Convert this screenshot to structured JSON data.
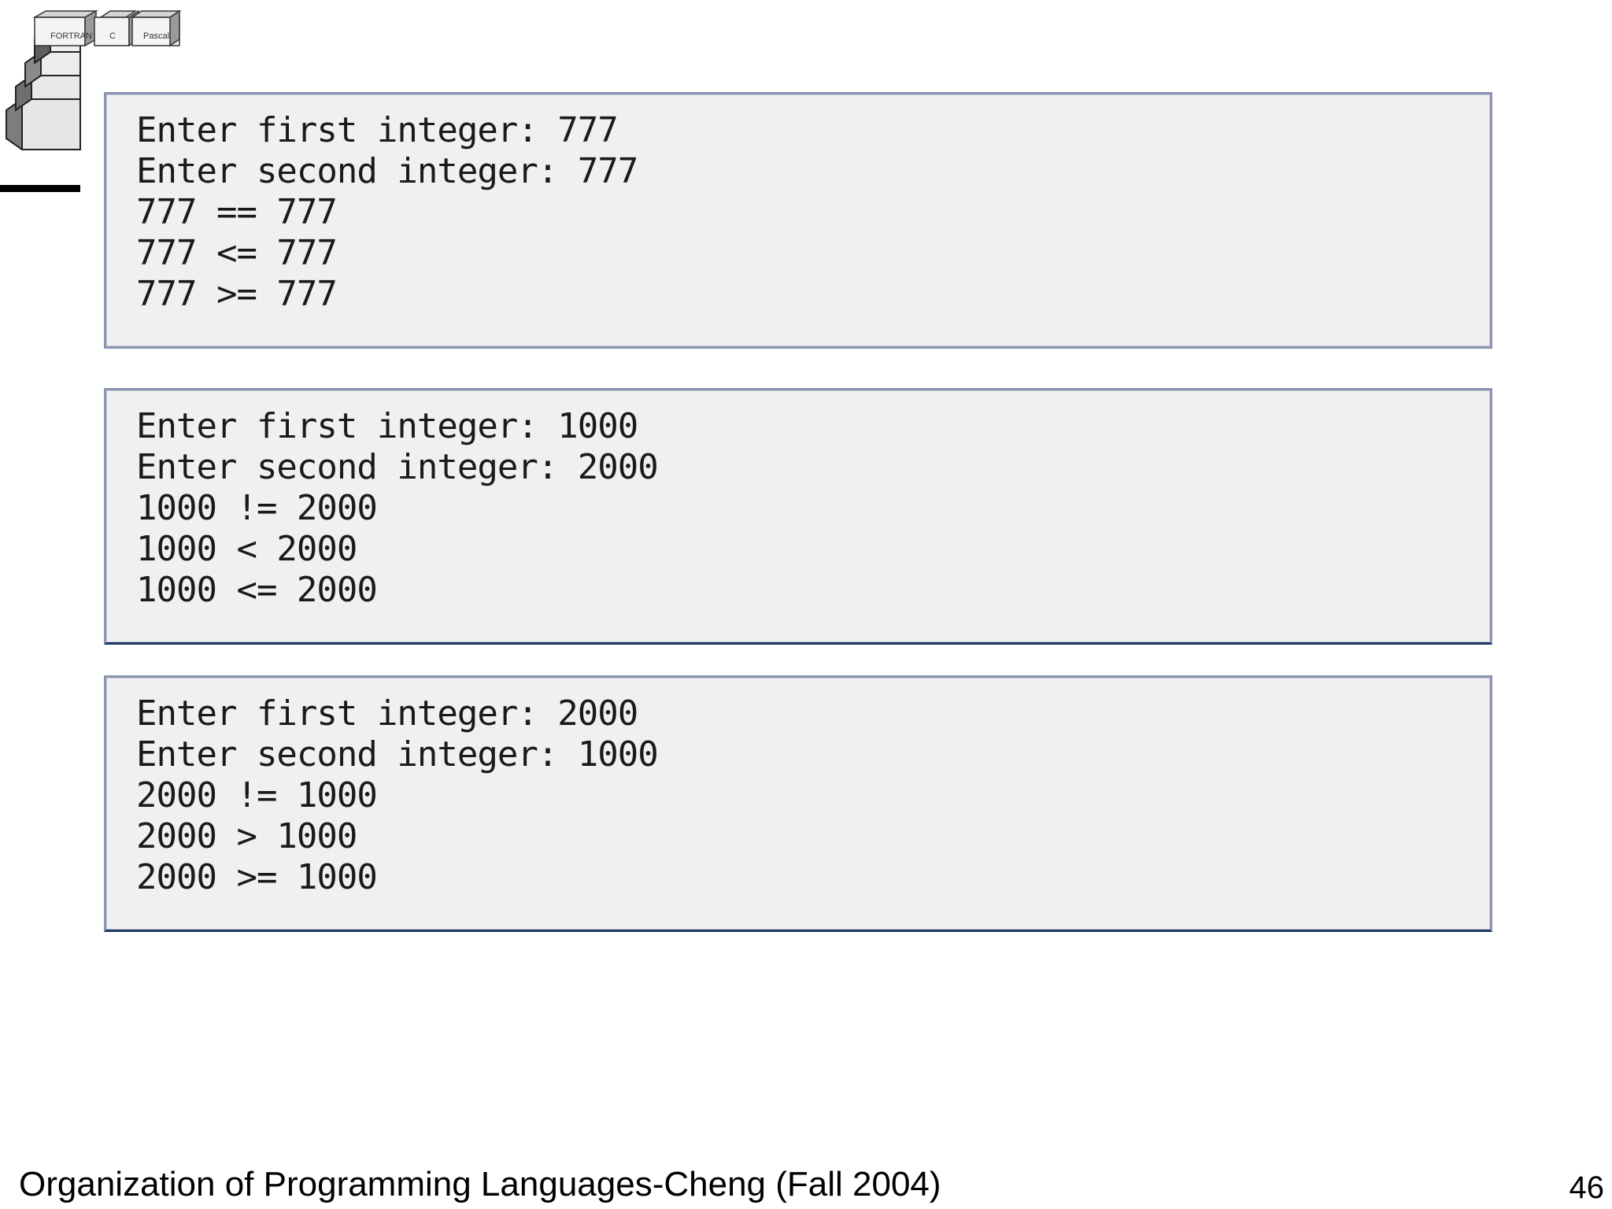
{
  "logo": {
    "tabs": [
      "FORTRAN",
      "C",
      "Pascal"
    ]
  },
  "panels": [
    {
      "lines": [
        "Enter first integer: 777",
        "Enter second integer: 777",
        "777 == 777",
        "777 <= 777",
        "777 >= 777"
      ]
    },
    {
      "lines": [
        "Enter first integer: 1000",
        "Enter second integer: 2000",
        "1000 != 2000",
        "1000 < 2000",
        "1000 <= 2000"
      ]
    },
    {
      "lines": [
        "Enter first integer: 2000",
        "Enter second integer: 1000",
        "2000 != 1000",
        "2000 > 1000",
        "2000 >= 1000"
      ]
    }
  ],
  "footer": {
    "title": "Organization of Programming Languages-Cheng (Fall 2004)",
    "page_number": "46"
  }
}
